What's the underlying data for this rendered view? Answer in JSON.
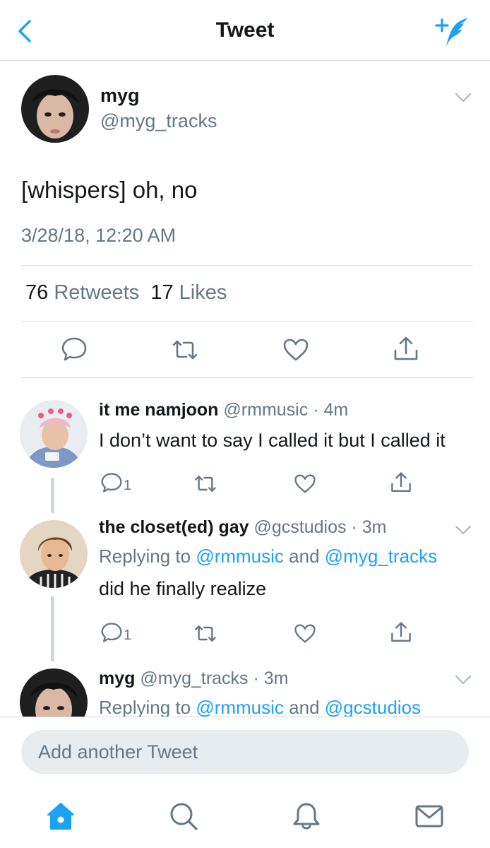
{
  "header": {
    "title": "Tweet"
  },
  "main_tweet": {
    "name": "myg",
    "handle": "@myg_tracks",
    "text": "[whispers] oh, no",
    "timestamp": "3/28/18, 12:20 AM",
    "retweets_count": "76",
    "retweets_label": "Retweets",
    "likes_count": "17",
    "likes_label": "Likes"
  },
  "replies": [
    {
      "name": "it me namjoon",
      "handle": "@rmmusic",
      "time": "· 4m",
      "text": "I don’t want to say I called it but I called it",
      "reply_count": "1"
    },
    {
      "name": "the closet(ed) gay",
      "handle": "@gcstudios",
      "time": "· 3m",
      "replying_prefix": "Replying to",
      "mention_1": "@rmmusic",
      "conjunction": "and",
      "mention_2": "@myg_tracks",
      "text": "did he finally realize",
      "reply_count": "1"
    },
    {
      "name": "myg",
      "handle": "@myg_tracks",
      "time": "· 3m",
      "replying_prefix": "Replying to",
      "mention_1": "@rmmusic",
      "conjunction": "and",
      "mention_2": "@gcstudios"
    }
  ],
  "compose": {
    "placeholder": "Add another Tweet"
  },
  "tabs": [
    "home-icon",
    "search-icon",
    "notifications-icon",
    "messages-icon"
  ],
  "colors": {
    "accent": "#1da1f2",
    "secondary_text": "#657786",
    "divider": "#d6dbe0",
    "icon_gray": "#657786"
  }
}
